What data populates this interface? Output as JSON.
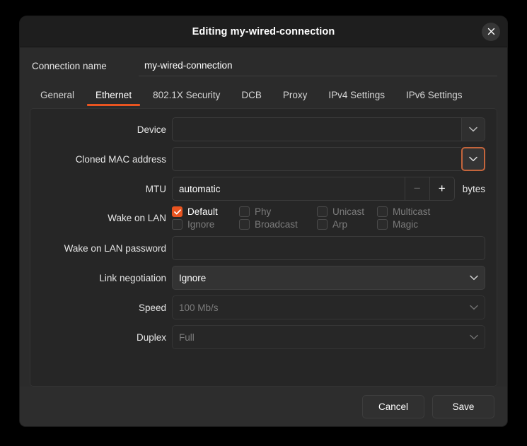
{
  "window": {
    "title": "Editing my-wired-connection",
    "close_icon": "close-icon"
  },
  "connection_name": {
    "label": "Connection name",
    "value": "my-wired-connection"
  },
  "tabs": [
    {
      "label": "General",
      "active": false
    },
    {
      "label": "Ethernet",
      "active": true
    },
    {
      "label": "802.1X Security",
      "active": false
    },
    {
      "label": "DCB",
      "active": false
    },
    {
      "label": "Proxy",
      "active": false
    },
    {
      "label": "IPv4 Settings",
      "active": false
    },
    {
      "label": "IPv6 Settings",
      "active": false
    }
  ],
  "ethernet": {
    "device": {
      "label": "Device",
      "value": "",
      "arrow_icon": "chevron-down-icon"
    },
    "cloned_mac": {
      "label": "Cloned MAC address",
      "value": "",
      "arrow_icon": "chevron-down-icon",
      "focused": true
    },
    "mtu": {
      "label": "MTU",
      "value": "automatic",
      "minus_label": "−",
      "plus_label": "+",
      "units": "bytes"
    },
    "wake_on_lan": {
      "label": "Wake on LAN",
      "options": [
        {
          "label": "Default",
          "checked": true,
          "enabled": true
        },
        {
          "label": "Phy",
          "checked": false,
          "enabled": false
        },
        {
          "label": "Unicast",
          "checked": false,
          "enabled": false
        },
        {
          "label": "Multicast",
          "checked": false,
          "enabled": false
        },
        {
          "label": "Ignore",
          "checked": false,
          "enabled": false
        },
        {
          "label": "Broadcast",
          "checked": false,
          "enabled": false
        },
        {
          "label": "Arp",
          "checked": false,
          "enabled": false
        },
        {
          "label": "Magic",
          "checked": false,
          "enabled": false
        }
      ]
    },
    "wol_password": {
      "label": "Wake on LAN password",
      "value": ""
    },
    "link_negotiation": {
      "label": "Link negotiation",
      "value": "Ignore",
      "enabled": true,
      "arrow_icon": "chevron-down-icon"
    },
    "speed": {
      "label": "Speed",
      "value": "100 Mb/s",
      "enabled": false,
      "arrow_icon": "chevron-down-icon"
    },
    "duplex": {
      "label": "Duplex",
      "value": "Full",
      "enabled": false,
      "arrow_icon": "chevron-down-icon"
    }
  },
  "footer": {
    "cancel_label": "Cancel",
    "save_label": "Save"
  },
  "colors": {
    "accent": "#e95420",
    "focus_ring": "#c4653c",
    "dialog_bg": "#2b2b2b",
    "panel_bg": "#262626"
  }
}
